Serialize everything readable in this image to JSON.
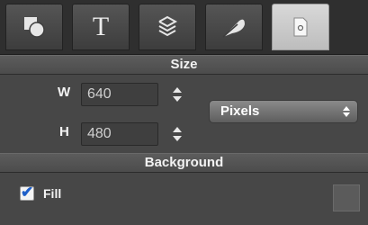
{
  "tabs": [
    {
      "icon": "shapes-icon",
      "label": ""
    },
    {
      "icon": "text-icon",
      "label": "T"
    },
    {
      "icon": "layers-icon",
      "label": ""
    },
    {
      "icon": "feather-icon",
      "label": ""
    },
    {
      "icon": "document-gear-icon",
      "label": ""
    }
  ],
  "size": {
    "header": "Size",
    "width_label": "W",
    "width_value": "640",
    "height_label": "H",
    "height_value": "480",
    "unit": "Pixels"
  },
  "background": {
    "header": "Background",
    "fill_label": "Fill",
    "fill_checked": true,
    "check_glyph": "✔"
  },
  "colors": {
    "panel": "#474747",
    "tab_active": "#cfcfcf",
    "checkmark": "#1e5fc9"
  }
}
